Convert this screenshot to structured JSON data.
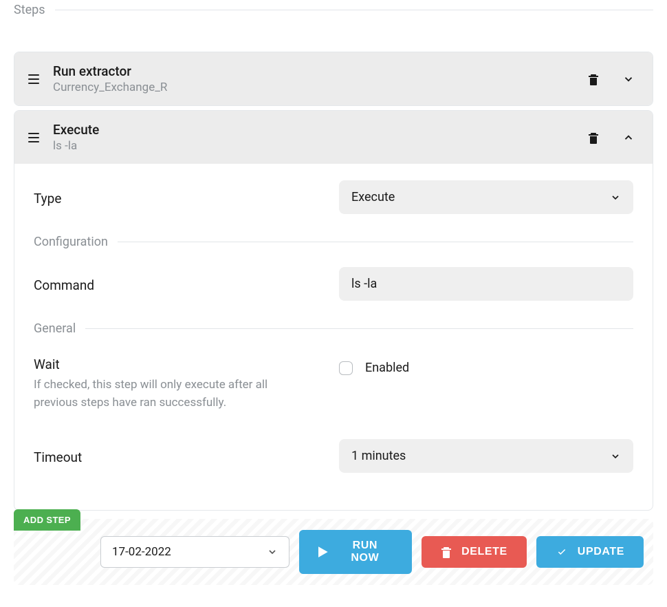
{
  "sections": {
    "steps_label": "Steps"
  },
  "steps": [
    {
      "title": "Run extractor",
      "subtitle": "Currency_Exchange_R",
      "expanded": false
    },
    {
      "title": "Execute",
      "subtitle": "ls -la",
      "expanded": true,
      "config": {
        "type_label": "Type",
        "type_value": "Execute",
        "configuration_label": "Configuration",
        "command_label": "Command",
        "command_value": "ls -la",
        "general_label": "General",
        "wait_label": "Wait",
        "wait_hint": "If checked, this step will only execute after all previous steps have ran successfully.",
        "wait_enabled_label": "Enabled",
        "wait_enabled_value": false,
        "timeout_label": "Timeout",
        "timeout_value": "1 minutes"
      }
    }
  ],
  "footer": {
    "add_step_label": "ADD STEP",
    "date_value": "17-02-2022",
    "run_label": "RUN NOW",
    "delete_label": "DELETE",
    "update_label": "UPDATE"
  }
}
